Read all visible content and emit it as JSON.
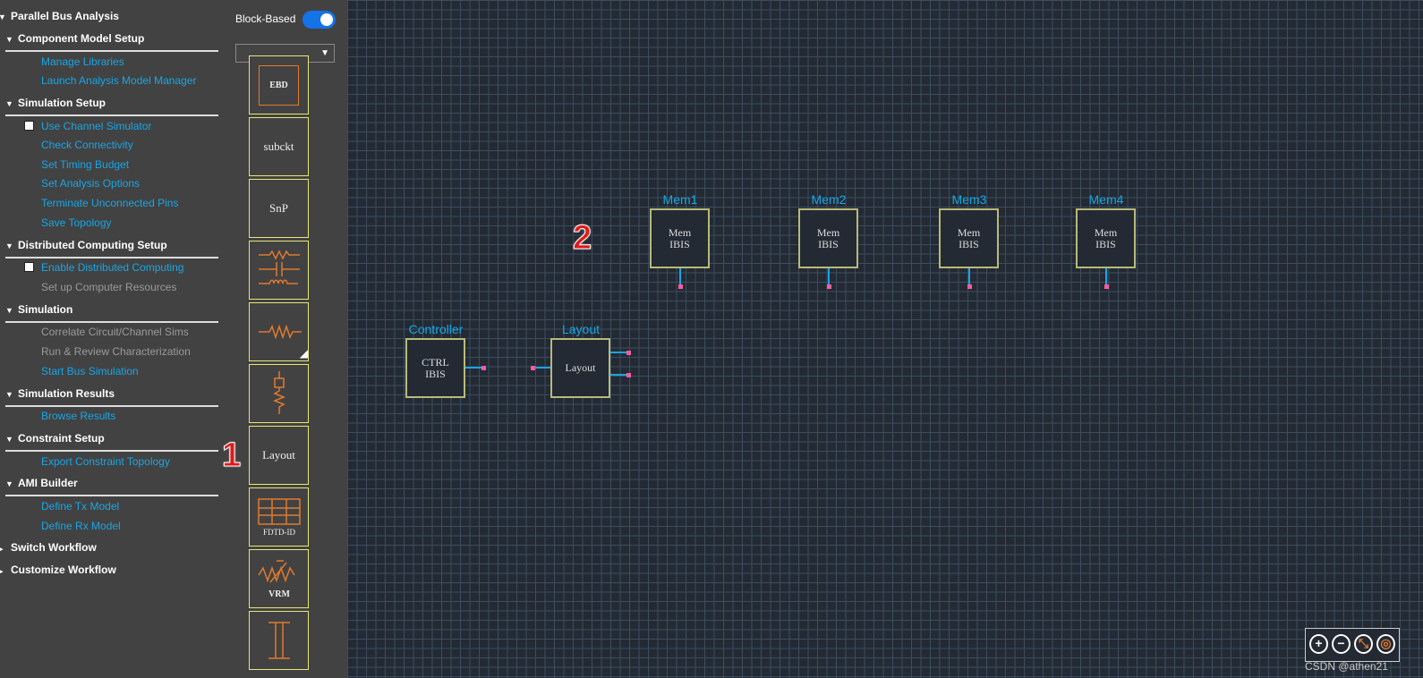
{
  "sidebar": {
    "root": "Parallel Bus Analysis",
    "sections": [
      {
        "title": "Component Model Setup",
        "items": [
          "Manage Libraries",
          "Launch Analysis Model Manager"
        ]
      },
      {
        "title": "Simulation Setup",
        "items": [
          "Use Channel Simulator",
          "Check Connectivity",
          "Set Timing Budget",
          "Set Analysis Options",
          "Terminate Unconnected Pins",
          "Save Topology"
        ]
      },
      {
        "title": "Distributed Computing Setup",
        "items": [
          "Enable Distributed Computing",
          "Set up Computer Resources"
        ]
      },
      {
        "title": "Simulation",
        "items": [
          "Correlate Circuit/Channel Sims",
          "Run & Review Characterization",
          "Start Bus Simulation"
        ]
      },
      {
        "title": "Simulation Results",
        "items": [
          "Browse Results"
        ]
      },
      {
        "title": "Constraint Setup",
        "items": [
          "Export Constraint Topology"
        ]
      },
      {
        "title": "AMI Builder",
        "items": [
          "Define Tx Model",
          "Define Rx Model"
        ]
      }
    ],
    "switch": "Switch Workflow",
    "customize": "Customize Workflow"
  },
  "palette": {
    "toggle_label": "Block-Based",
    "toggle_on": true,
    "dropdown_value": "",
    "tiles": [
      "EBD",
      "subckt",
      "SnP",
      "RLC",
      "Resistor",
      "Termination",
      "Layout",
      "FDTD-ID",
      "VRM",
      "Transmission Line"
    ]
  },
  "canvas": {
    "blocks": {
      "mem1": {
        "title": "Mem1",
        "body": "Mem IBIS"
      },
      "mem2": {
        "title": "Mem2",
        "body": "Mem IBIS"
      },
      "mem3": {
        "title": "Mem3",
        "body": "Mem IBIS"
      },
      "mem4": {
        "title": "Mem4",
        "body": "Mem IBIS"
      },
      "ctrl": {
        "title": "Controller",
        "body": "CTRL IBIS"
      },
      "layout": {
        "title": "Layout",
        "body": "Layout"
      }
    },
    "annotations": [
      "1",
      "2"
    ]
  },
  "watermark": "CSDN @athen21",
  "colors": {
    "link": "#17a6e6",
    "canvas": "#232a33",
    "accent": "#1473e6"
  }
}
